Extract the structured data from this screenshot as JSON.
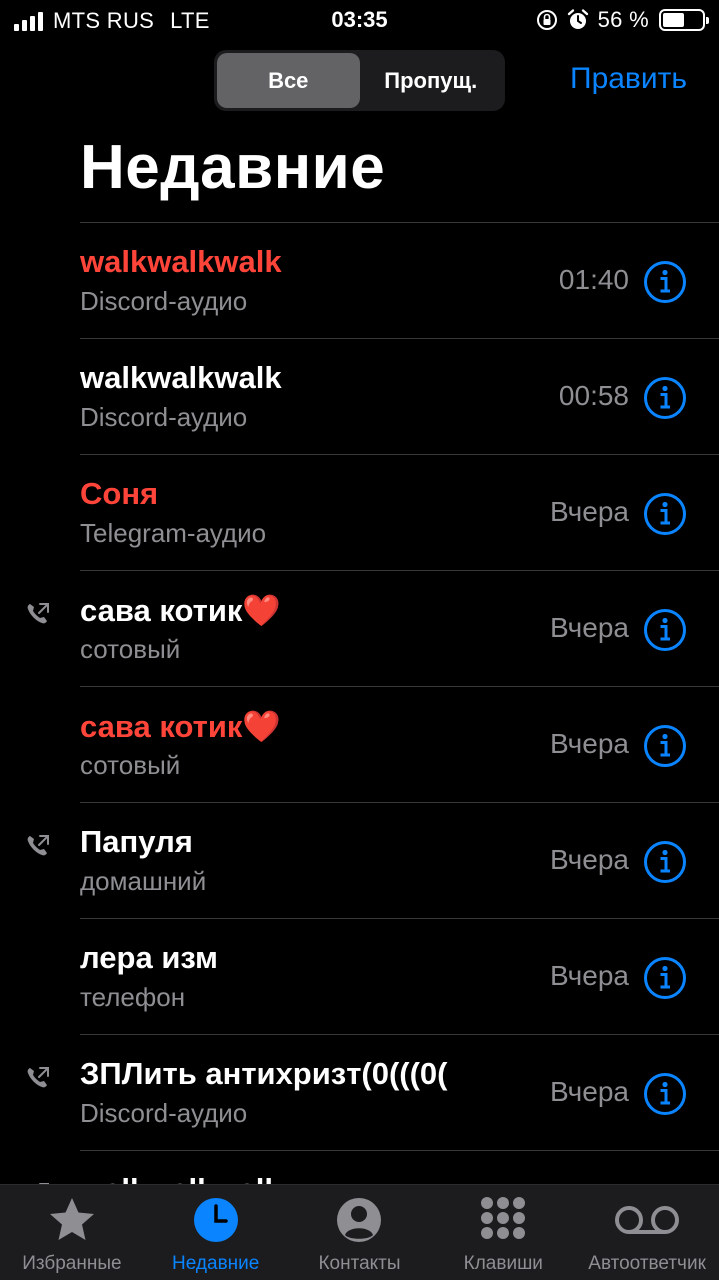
{
  "status_bar": {
    "carrier": "MTS RUS",
    "network": "LTE",
    "time": "03:35",
    "battery": "56 %",
    "battery_level": 0.56
  },
  "segmented": {
    "all": "Все",
    "missed": "Пропущ."
  },
  "edit_label": "Править",
  "title": "Недавние",
  "calls": [
    {
      "name": "walkwalkwalk",
      "type": "Discord-аудио",
      "time": "01:40",
      "missed": true,
      "outgoing": false
    },
    {
      "name": "walkwalkwalk",
      "type": "Discord-аудио",
      "time": "00:58",
      "missed": false,
      "outgoing": false
    },
    {
      "name": "Соня",
      "type": "Telegram-аудио",
      "time": "Вчера",
      "missed": true,
      "outgoing": false
    },
    {
      "name": "сава котик❤️",
      "type": "сотовый",
      "time": "Вчера",
      "missed": false,
      "outgoing": true
    },
    {
      "name": "сава котик❤️",
      "type": "сотовый",
      "time": "Вчера",
      "missed": true,
      "outgoing": false
    },
    {
      "name": "Папуля",
      "type": "домашний",
      "time": "Вчера",
      "missed": false,
      "outgoing": true
    },
    {
      "name": "лера изм",
      "type": "телефон",
      "time": "Вчера",
      "missed": false,
      "outgoing": false
    },
    {
      "name": "ЗПЛить антихризт(0(((0(",
      "type": "Discord-аудио",
      "time": "Вчера",
      "missed": false,
      "outgoing": true
    },
    {
      "name": "walkwalkwalk",
      "type": "",
      "time": "",
      "missed": false,
      "outgoing": true
    }
  ],
  "tabs": [
    {
      "label": "Избранные",
      "icon": "star-icon",
      "active": false
    },
    {
      "label": "Недавние",
      "icon": "clock-icon",
      "active": true
    },
    {
      "label": "Контакты",
      "icon": "person-circle-icon",
      "active": false
    },
    {
      "label": "Клавиши",
      "icon": "keypad-icon",
      "active": false
    },
    {
      "label": "Автоответчик",
      "icon": "voicemail-icon",
      "active": false
    }
  ],
  "colors": {
    "accent": "#0a84ff",
    "missed": "#ff453a",
    "secondary": "#8e8e93",
    "separator": "#38383a",
    "tab_bar": "#1c1c1e"
  }
}
